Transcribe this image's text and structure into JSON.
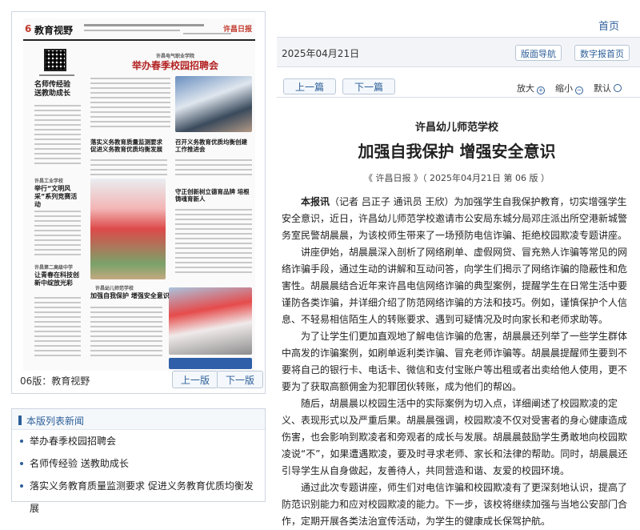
{
  "left": {
    "page_caption": "06版：教育视野",
    "prev_page": "上一版",
    "next_page": "下一版",
    "newspaper": {
      "page_num": "6",
      "section": "教育视野",
      "logo": "许昌日报",
      "headline_main": "举办春季校园招聘会",
      "headline_main_kicker": "许昌电气职业学院",
      "side1": "名师传经验 送教助成长",
      "side2": "举行“文明风采”系列竞赛活动",
      "side2_kicker": "许昌工业学校",
      "side3": "让青春在科技创新中绽放光彩",
      "side3_kicker": "许昌第二高级中学",
      "mid1": "落实义务教育质量监测要求 促进义务教育优质均衡发展",
      "mid2": "召开义务教育优质均衡创建工作推进会",
      "mid3": "守正创新树立德育品牌 培根铸魂育新人",
      "bottom_head": "加强自我保护 增强安全意识",
      "bottom_kicker": "许昌幼儿师范学校"
    }
  },
  "list": {
    "heading": "本版列表新闻",
    "items": [
      "举办春季校园招聘会",
      "名师传经验 送教助成长",
      "落实义务教育质量监测要求 促进义务教育优质均衡发展"
    ]
  },
  "right": {
    "home": "首页",
    "date": "2025年04月21日",
    "nav_btn": "版面导航",
    "digital_btn": "数字报首页",
    "prev_article": "上一篇",
    "next_article": "下一篇",
    "zoom_in": "放大",
    "zoom_out": "缩小",
    "default": "默认",
    "article": {
      "kicker": "许昌幼儿师范学校",
      "title": "加强自我保护 增强安全意识",
      "source": "《 许昌日报 》（ 2025年04月21日 第 06 版 ）",
      "lead": "本报讯",
      "p1": "（记者 吕正子 通讯员 王欣）为加强学生自我保护教育，切实增强学生安全意识，近日，许昌幼儿师范学校邀请市公安局东城分局邓庄派出所空港新城警务室民警胡晨晨，为该校师生带来了一场预防电信诈骗、拒绝校园欺凌专题讲座。",
      "p2": "讲座伊始，胡晨晨深入剖析了网络刷单、虚假网贷、冒充熟人诈骗等常见的网络诈骗手段，通过生动的讲解和互动问答，向学生们揭示了网络诈骗的隐蔽性和危害性。胡晨晨结合近年来许昌电信网络诈骗的典型案例，提醒学生在日常生活中要谨防各类诈骗，并详细介绍了防范网络诈骗的方法和技巧。例如，谨慎保护个人信息、不轻易相信陌生人的转账要求、遇到可疑情况及时向家长和老师求助等。",
      "p3": "为了让学生们更加直观地了解电信诈骗的危害，胡晨晨还列举了一些学生群体中高发的诈骗案例，如刷单返利类诈骗、冒充老师诈骗等。胡晨晨提醒师生要到不要将自己的银行卡、电话卡、微信和支付宝账户等出租或者出卖给他人使用，更不要为了获取高额佣金为犯罪团伙转账，成为他们的帮凶。",
      "p4": "随后，胡晨晨以校园生活中的实际案例为切入点，详细阐述了校园欺凌的定义、表现形式以及严重后果。胡晨晨强调，校园欺凌不仅对受害者的身心健康造成伤害，也会影响到欺凌者和旁观者的成长与发展。胡晨晨鼓励学生勇敢地向校园欺凌说“不”，如果遭遇欺凌，要及时寻求老师、家长和法律的帮助。同时，胡晨晨还引导学生从自身做起，友善待人，共同营造和谐、友爱的校园环境。",
      "p5": "通过此次专题讲座，师生们对电信诈骗和校园欺凌有了更深刻地认识，提高了防范识别能力和应对校园欺凌的能力。下一步，该校将继续加强与当地公安部门合作，定期开展各类法治宣传活动，为学生的健康成长保驾护航。"
    }
  }
}
